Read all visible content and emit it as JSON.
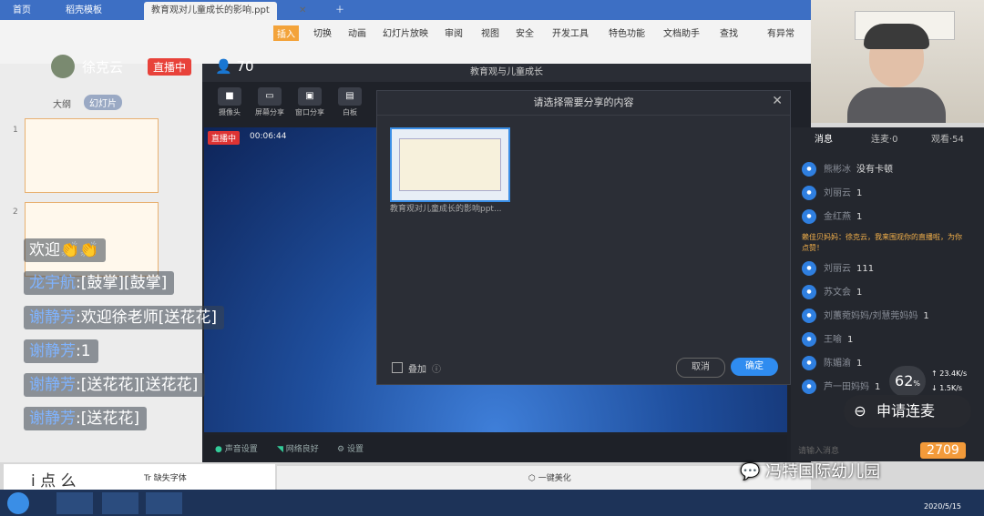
{
  "tabs": [
    "首页",
    "稻壳模板",
    "教育观对儿童成长的影响.ppt"
  ],
  "menu": [
    "切换",
    "动画",
    "幻灯片放映",
    "审阅",
    "视图",
    "安全",
    "开发工具",
    "特色功能",
    "文档助手",
    "查找"
  ],
  "menu_extra": "有异常",
  "insert_label": "插入",
  "streamer": {
    "name": "徐克云",
    "live_badge": "直播中",
    "viewers": "70"
  },
  "panel_tabs": {
    "outline": "大纲",
    "slides": "幻灯片"
  },
  "live_app": {
    "title": "教育观与儿童成长",
    "tools": [
      "摄像头",
      "屏幕分享",
      "窗口分享",
      "白板"
    ],
    "live_tag": "直播中",
    "timer": "00:06:44",
    "bottom": [
      "声音设置",
      "网络良好",
      "设置"
    ]
  },
  "dialog": {
    "title": "请选择需要分享的内容",
    "file": "教育观对儿童成长的影响ppt...",
    "overlay_label": "叠加",
    "cancel": "取消",
    "confirm": "确定"
  },
  "chat": {
    "tabs": [
      "消息",
      "连麦·0",
      "观看·54"
    ],
    "messages": [
      {
        "name": "熊彬冰",
        "text": "没有卡顿"
      },
      {
        "name": "刘丽云",
        "text": "1"
      },
      {
        "name": "金红燕",
        "text": "1"
      },
      {
        "name": "",
        "text": "赖佳贝妈妈：徐克云，我来围观你的直播啦，为你点赞！",
        "system": true
      },
      {
        "name": "刘丽云",
        "text": "111"
      },
      {
        "name": "苏文会",
        "text": "1"
      },
      {
        "name": "刘蕙菀妈妈/刘慧莞妈妈",
        "text": "1"
      },
      {
        "name": "王喻",
        "text": "1"
      },
      {
        "name": "陈媚渝",
        "text": "1"
      },
      {
        "name": "芦一田妈妈",
        "text": "1"
      }
    ],
    "input_placeholder": "请输入消息"
  },
  "danmu": [
    {
      "name": "",
      "text": "欢迎👏👏"
    },
    {
      "name": "龙宇航",
      "text": "[鼓掌][鼓掌]"
    },
    {
      "name": "谢静芳",
      "text": "欢迎徐老师[送花花]"
    },
    {
      "name": "谢静芳",
      "text": "1"
    },
    {
      "name": "谢静芳",
      "text": "[送花花][送花花]"
    },
    {
      "name": "谢静芳",
      "text": "[送花花]"
    }
  ],
  "network": {
    "percent": "62",
    "up": "23.4K/s",
    "down": "1.5K/s"
  },
  "apply_mic": "申请连麦",
  "likes": "2709",
  "bottom_chars": "i 点 么",
  "missing_font": "缺失字体",
  "beautify": "一键美化",
  "watermark": "冯特国际幼儿园",
  "clock": {
    "time": "",
    "date": "2020/5/15"
  }
}
